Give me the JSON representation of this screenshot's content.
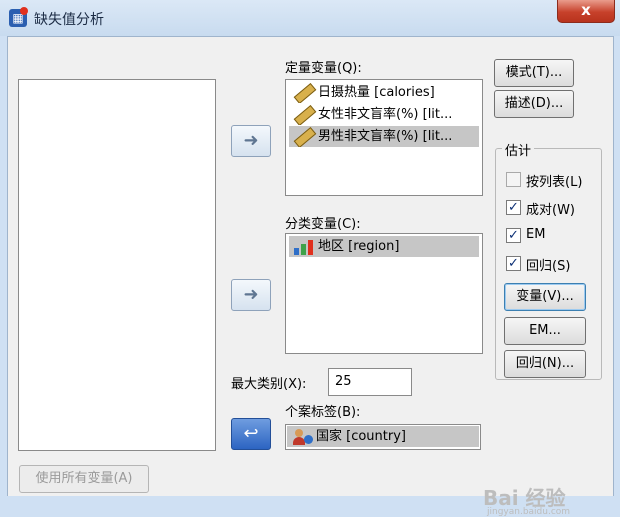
{
  "window": {
    "title": "缺失值分析",
    "close_label": "x"
  },
  "icons": {
    "app": "app-icon",
    "ruler": "ruler-icon",
    "bar": "bar-chart-icon",
    "person": "person-icon",
    "arrow": "arrow-right-icon",
    "arrow_left": "arrow-left-icon"
  },
  "quantitative": {
    "label": "定量变量(Q):",
    "items": [
      "日摄热量 [calories]",
      "女性非文盲率(%) [lit...",
      "男性非文盲率(%) [lit..."
    ]
  },
  "categorical": {
    "label": "分类变量(C):",
    "items": [
      "地区 [region]"
    ]
  },
  "max_categories": {
    "label": "最大类别(X):",
    "value": "25"
  },
  "case_labels": {
    "label": "个案标签(B):",
    "value": "国家 [country]"
  },
  "buttons": {
    "patterns": "模式(T)...",
    "descriptives": "描述(D)...",
    "variables": "变量(V)...",
    "em": "EM...",
    "regression": "回归(N)...",
    "use_all": "使用所有变量(A)"
  },
  "estimation": {
    "legend": "估计",
    "options": [
      {
        "label": "按列表(L)",
        "checked": false
      },
      {
        "label": "成对(W)",
        "checked": true
      },
      {
        "label": "EM",
        "checked": true
      },
      {
        "label": "回归(S)",
        "checked": true
      }
    ]
  },
  "watermark": {
    "main": "Bai 经验",
    "sub": "jingyan.baidu.com"
  },
  "colors": {
    "selection": "#c6c6c6",
    "frame": "#cfe0f3",
    "close": "#c7412b"
  }
}
